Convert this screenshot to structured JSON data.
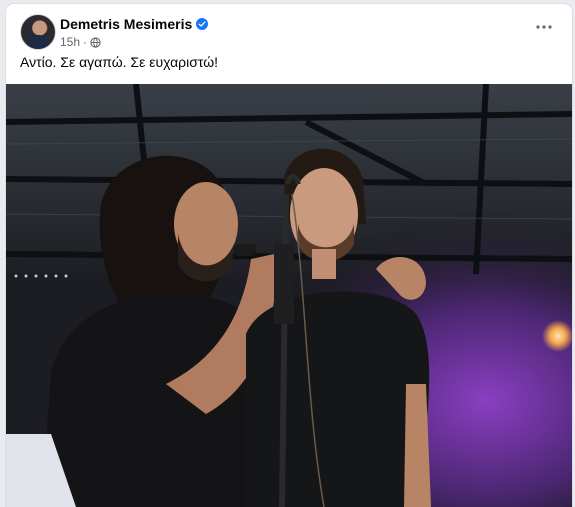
{
  "post": {
    "author": "Demetris Mesimeris",
    "verified_icon": "verified-badge-icon",
    "time": "15h",
    "separator": "·",
    "audience_icon": "globe-icon",
    "more_icon": "more-options-icon",
    "caption": "Αντίο. Σε αγαπώ. Σε ευχαριστώ!",
    "photo": "concert-stage-photo"
  },
  "colors": {
    "accent": "#1877f2",
    "secondary_text": "#65676b",
    "stage_light": "#8a3fc2"
  }
}
